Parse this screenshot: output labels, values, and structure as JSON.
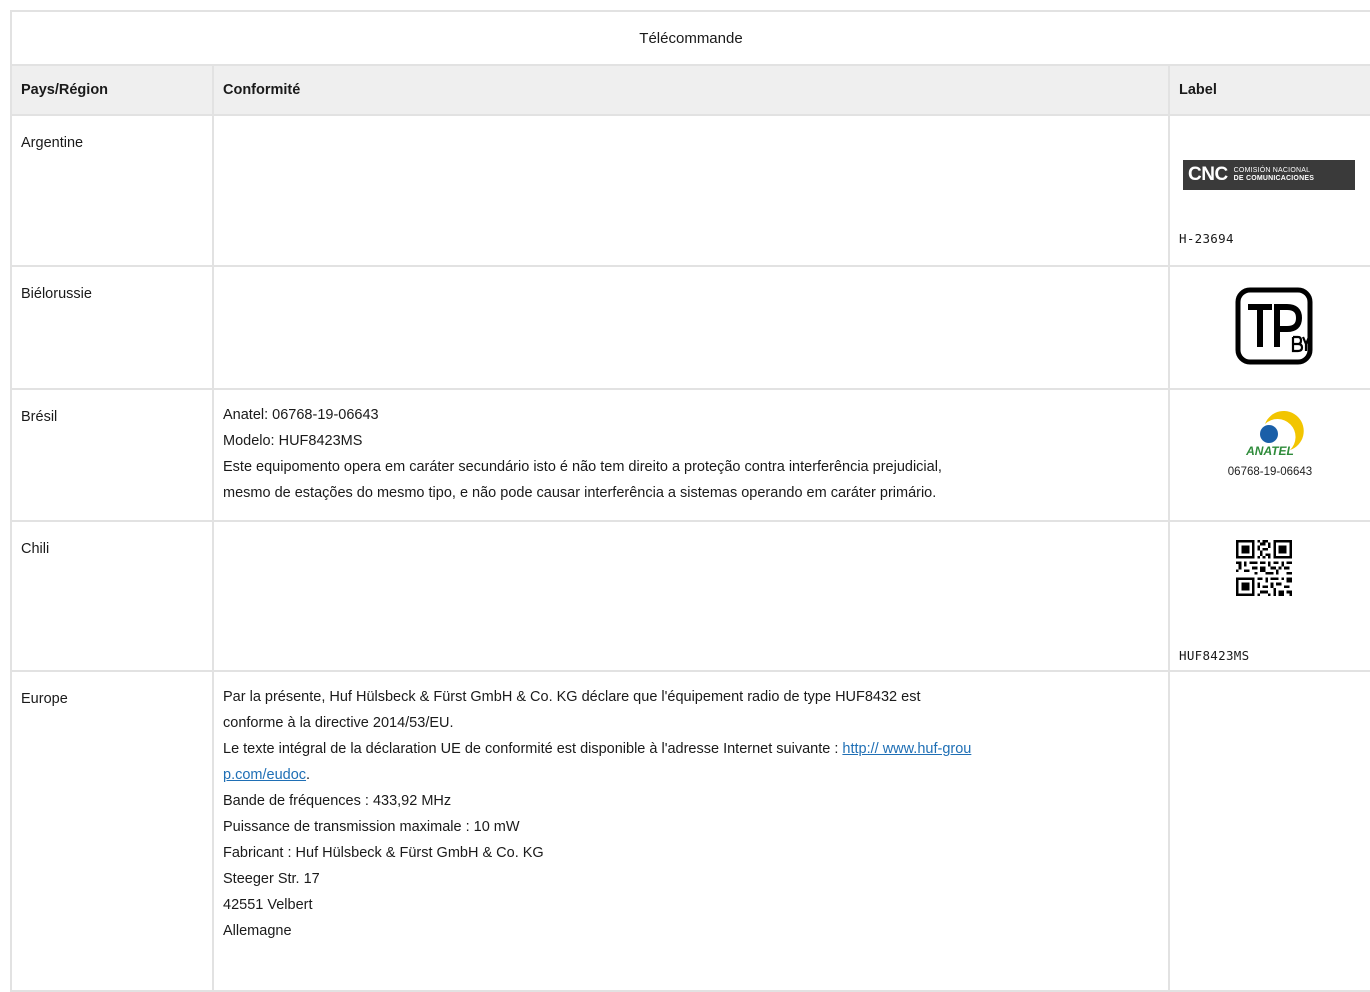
{
  "title": "Télécommande",
  "headers": {
    "country": "Pays/Région",
    "compliance": "Conformité",
    "label": "Label"
  },
  "rows": [
    {
      "country": "Argentine",
      "compliance": [],
      "label": {
        "logo": "cnc-logo",
        "logo_main": "CNC",
        "logo_sub_1": "COMISIÓN NACIONAL",
        "logo_sub_2": "DE COMUNICACIONES",
        "code": "H-23694"
      }
    },
    {
      "country": "Biélorussie",
      "compliance": [],
      "label": {
        "logo": "tp-by-mark"
      }
    },
    {
      "country": "Brésil",
      "compliance": [
        "Anatel: 06768-19-06643",
        "Modelo: HUF8423MS",
        "Este equipomento opera em caráter secundário isto é não tem direito a proteção contra interferência prejudicial,",
        "mesmo de estações do mesmo tipo, e não pode causar interferência a sistemas operando em caráter primário."
      ],
      "label": {
        "logo": "anatel-logo",
        "logo_text": "ANATEL",
        "code": "06768-19-06643"
      }
    },
    {
      "country": "Chili",
      "compliance": [],
      "label": {
        "logo": "qr-code",
        "code": "HUF8423MS"
      }
    },
    {
      "country": "Europe",
      "compliance_intro_1": "Par la présente, Huf Hülsbeck & Fürst GmbH & Co. KG déclare que l'équipement radio de type HUF8432 est",
      "compliance_intro_2": "conforme à la directive 2014/53/EU.",
      "compliance_link_text": "Le texte intégral de la déclaration UE de conformité est disponible à l'adresse Internet suivante :",
      "compliance_link_1": "http:// www.huf-grou",
      "compliance_link_2": "p.com/eudoc",
      "compliance_rest": [
        "Bande de fréquences : 433,92 MHz",
        "Puissance de transmission maximale : 10 mW",
        "Fabricant : Huf Hülsbeck & Fürst GmbH & Co. KG",
        "Steeger Str. 17",
        "42551 Velbert",
        "Allemagne"
      ],
      "label": {}
    }
  ],
  "colors": {
    "border": "#e2e2e2",
    "header_bg": "#efefef",
    "link": "#1f6fb5",
    "anatel_blue": "#1a5fa8",
    "anatel_yellow": "#f2c500",
    "anatel_green": "#2e8b3a"
  }
}
